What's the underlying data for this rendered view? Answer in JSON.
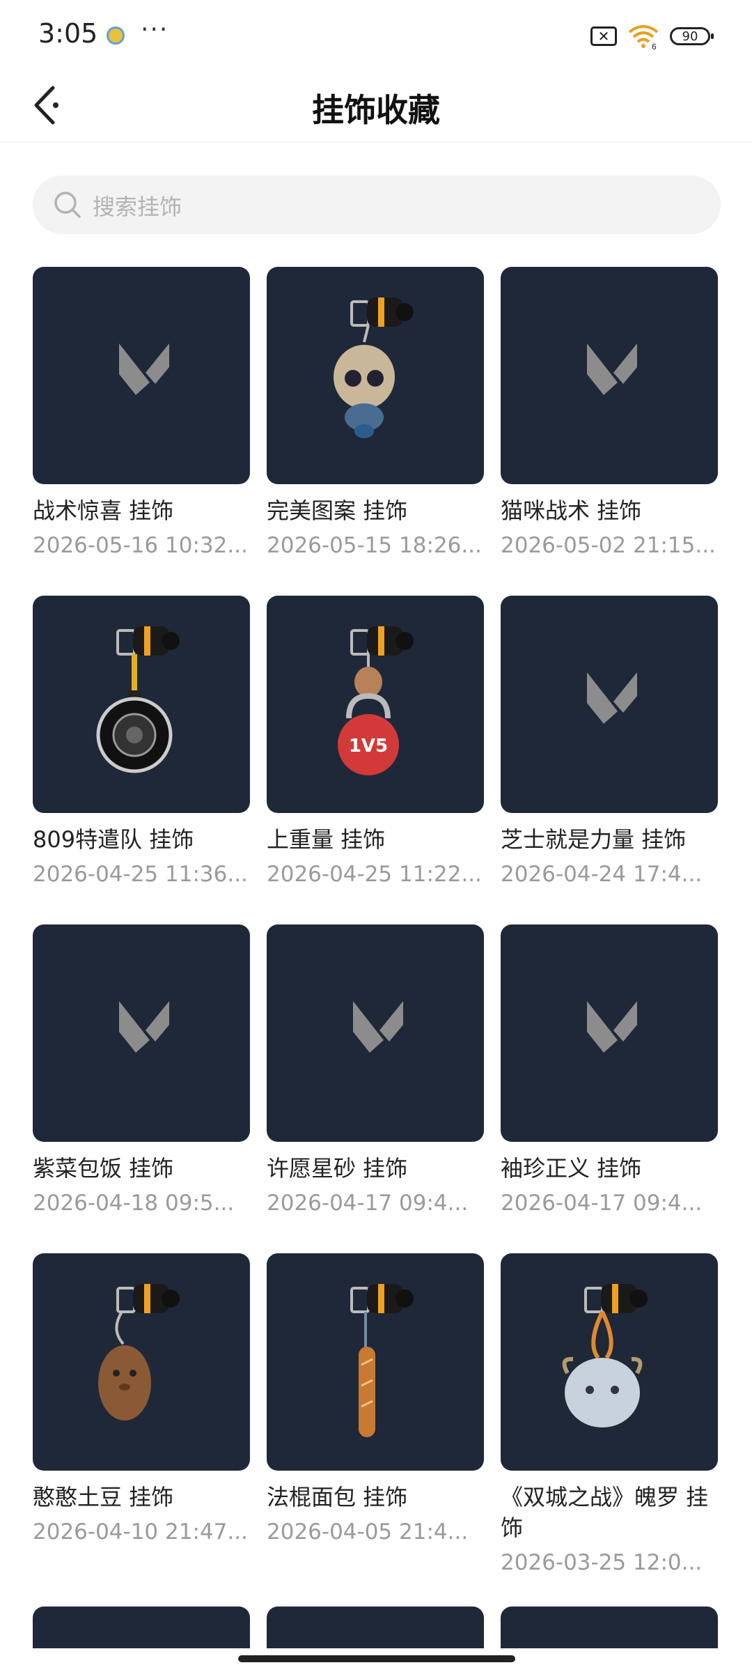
{
  "status_bar": {
    "time": "3:05",
    "dots": "···",
    "battery_level": "90",
    "wifi_label": "6"
  },
  "header": {
    "title": "挂饰收藏"
  },
  "search": {
    "placeholder": "搜索挂饰"
  },
  "items": [
    {
      "title": "战术惊喜 挂饰",
      "date": "2026-05-16 10:32...",
      "image": "placeholder"
    },
    {
      "title": "完美图案 挂饰",
      "date": "2026-05-15 18:26...",
      "image": "doll-charm"
    },
    {
      "title": "猫咪战术 挂饰",
      "date": "2026-05-02 21:15...",
      "image": "placeholder"
    },
    {
      "title": "809特遣队 挂饰",
      "date": "2026-04-25 11:36...",
      "image": "lens-charm"
    },
    {
      "title": "上重量 挂饰",
      "date": "2026-04-25 11:22...",
      "image": "kettlebell-charm"
    },
    {
      "title": "芝士就是力量 挂饰",
      "date": "2026-04-24 17:4...",
      "image": "placeholder"
    },
    {
      "title": "紫菜包饭 挂饰",
      "date": "2026-04-18 09:5...",
      "image": "placeholder"
    },
    {
      "title": "许愿星砂 挂饰",
      "date": "2026-04-17 09:4...",
      "image": "placeholder"
    },
    {
      "title": "袖珍正义 挂饰",
      "date": "2026-04-17 09:4...",
      "image": "placeholder"
    },
    {
      "title": "憨憨土豆 挂饰",
      "date": "2026-04-10 21:47...",
      "image": "potato-charm"
    },
    {
      "title": "法棍面包 挂饰",
      "date": "2026-04-05 21:4...",
      "image": "baguette-charm"
    },
    {
      "title": "《双城之战》魄罗 挂饰",
      "date": "2026-03-25 12:0...",
      "image": "poro-charm"
    }
  ],
  "colors": {
    "card_bg": "#1f2838",
    "logo": "#8c8c8c",
    "accent_orange": "#f0a020"
  }
}
